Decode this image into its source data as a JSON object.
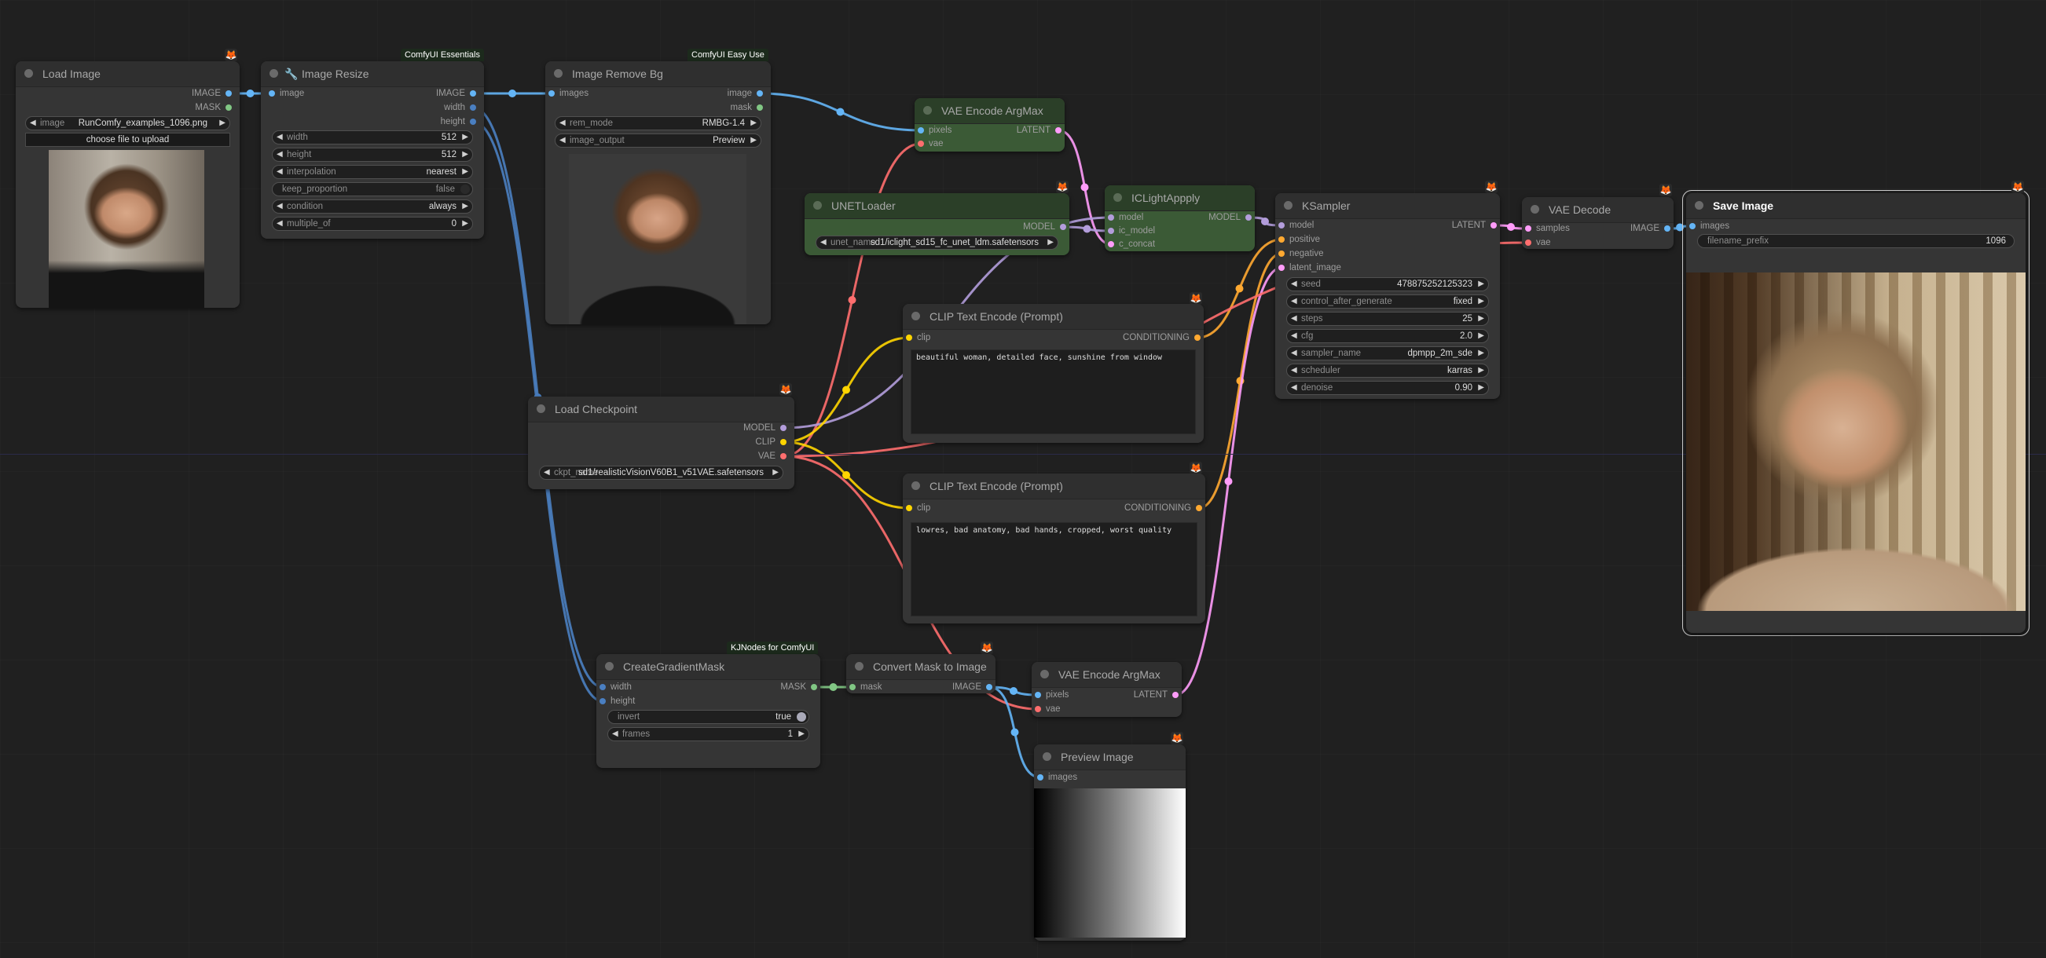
{
  "canvas": {
    "background": "#202020"
  },
  "colors": {
    "IMAGE": "#64b5f6",
    "MASK": "#81c784",
    "INT": "#4a7fc1",
    "LATENT": "#ff9cf9",
    "MODEL": "#b39ddb",
    "CLIP": "#ffd500",
    "VAE": "#ff6e6e",
    "CONDITIONING": "#ffa931"
  },
  "badges": {
    "essentials": "ComfyUI Essentials",
    "easy_use": "ComfyUI Easy Use",
    "kjnodes": "KJNodes for ComfyUI",
    "fox_icon": "🦊"
  },
  "nodes": {
    "load_image": {
      "title": "Load Image",
      "outputs": [
        "IMAGE",
        "MASK"
      ],
      "widget": {
        "label": "image",
        "value": "RunComfy_examples_1096.png"
      },
      "upload_label": "choose file to upload"
    },
    "image_resize": {
      "title": "Image Resize",
      "title_icon": "wrench-icon",
      "inputs": [
        "image"
      ],
      "outputs": [
        "IMAGE",
        "width",
        "height"
      ],
      "widgets": [
        {
          "label": "width",
          "value": "512"
        },
        {
          "label": "height",
          "value": "512"
        },
        {
          "label": "interpolation",
          "value": "nearest"
        },
        {
          "label": "keep_proportion",
          "value": "false"
        },
        {
          "label": "condition",
          "value": "always"
        },
        {
          "label": "multiple_of",
          "value": "0"
        }
      ]
    },
    "image_remove_bg": {
      "title": "Image Remove Bg",
      "inputs": [
        "images"
      ],
      "outputs": [
        "image",
        "mask"
      ],
      "widgets": [
        {
          "label": "rem_mode",
          "value": "RMBG-1.4"
        },
        {
          "label": "image_output",
          "value": "Preview"
        }
      ]
    },
    "vae_encode_argmax_1": {
      "title": "VAE Encode ArgMax",
      "inputs": [
        "pixels",
        "vae"
      ],
      "outputs": [
        "LATENT"
      ]
    },
    "unet_loader": {
      "title": "UNETLoader",
      "outputs": [
        "MODEL"
      ],
      "widget": {
        "label": "unet_name",
        "value": "sd1/iclight_sd15_fc_unet_ldm.safetensors"
      }
    },
    "iclight_apply": {
      "title": "ICLightAppply",
      "inputs": [
        "model",
        "ic_model",
        "c_concat"
      ],
      "outputs": [
        "MODEL"
      ]
    },
    "ksampler": {
      "title": "KSampler",
      "inputs": [
        "model",
        "positive",
        "negative",
        "latent_image"
      ],
      "outputs": [
        "LATENT"
      ],
      "widgets": [
        {
          "label": "seed",
          "value": "478875252125323"
        },
        {
          "label": "control_after_generate",
          "value": "fixed"
        },
        {
          "label": "steps",
          "value": "25"
        },
        {
          "label": "cfg",
          "value": "2.0"
        },
        {
          "label": "sampler_name",
          "value": "dpmpp_2m_sde"
        },
        {
          "label": "scheduler",
          "value": "karras"
        },
        {
          "label": "denoise",
          "value": "0.90"
        }
      ]
    },
    "vae_decode": {
      "title": "VAE Decode",
      "inputs": [
        "samples",
        "vae"
      ],
      "outputs": [
        "IMAGE"
      ]
    },
    "save_image": {
      "title": "Save Image",
      "inputs": [
        "images"
      ],
      "widget": {
        "label": "filename_prefix",
        "value": "1096"
      }
    },
    "clip_text_encode_positive": {
      "title": "CLIP Text Encode (Prompt)",
      "inputs": [
        "clip"
      ],
      "outputs": [
        "CONDITIONING"
      ],
      "text": "beautiful woman, detailed face, sunshine from window"
    },
    "load_checkpoint": {
      "title": "Load Checkpoint",
      "outputs": [
        "MODEL",
        "CLIP",
        "VAE"
      ],
      "widget": {
        "label": "ckpt_name",
        "value": "sd1/realisticVisionV60B1_v51VAE.safetensors"
      }
    },
    "clip_text_encode_negative": {
      "title": "CLIP Text Encode (Prompt)",
      "inputs": [
        "clip"
      ],
      "outputs": [
        "CONDITIONING"
      ],
      "text": "lowres, bad anatomy, bad hands, cropped, worst quality"
    },
    "create_gradient_mask": {
      "title": "CreateGradientMask",
      "inputs": [
        "width",
        "height"
      ],
      "outputs": [
        "MASK"
      ],
      "widgets": [
        {
          "label": "invert",
          "value": "true"
        },
        {
          "label": "frames",
          "value": "1"
        }
      ]
    },
    "convert_mask_to_image": {
      "title": "Convert Mask to Image",
      "inputs": [
        "mask"
      ],
      "outputs": [
        "IMAGE"
      ]
    },
    "vae_encode_argmax_2": {
      "title": "VAE Encode ArgMax",
      "inputs": [
        "pixels",
        "vae"
      ],
      "outputs": [
        "LATENT"
      ]
    },
    "preview_image": {
      "title": "Preview Image",
      "inputs": [
        "images"
      ]
    }
  }
}
